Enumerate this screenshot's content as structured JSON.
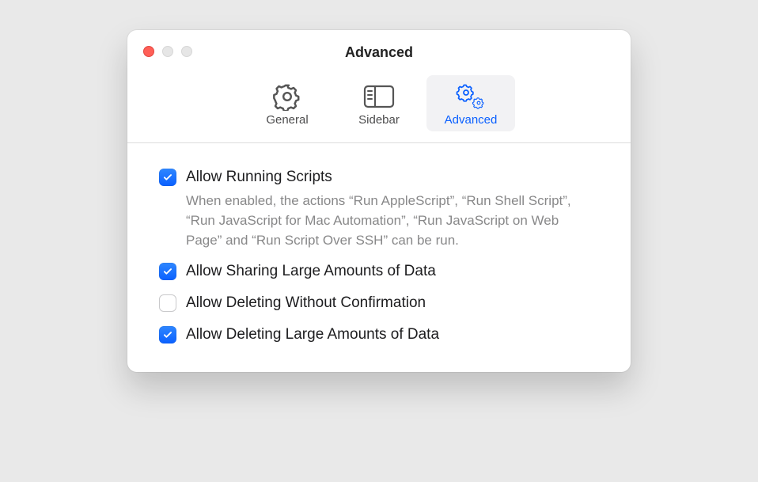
{
  "window": {
    "title": "Advanced"
  },
  "toolbar": {
    "tabs": [
      {
        "label": "General"
      },
      {
        "label": "Sidebar"
      },
      {
        "label": "Advanced"
      }
    ]
  },
  "settings": [
    {
      "label": "Allow Running Scripts",
      "description": "When enabled, the actions “Run AppleScript”, “Run Shell Script”, “Run JavaScript for Mac Automation”, “Run JavaScript on Web Page” and “Run Script Over SSH” can be run.",
      "checked": true
    },
    {
      "label": "Allow Sharing Large Amounts of Data",
      "description": "",
      "checked": true
    },
    {
      "label": "Allow Deleting Without Confirmation",
      "description": "",
      "checked": false
    },
    {
      "label": "Allow Deleting Large Amounts of Data",
      "description": "",
      "checked": true
    }
  ],
  "colors": {
    "accent": "#0a60ff"
  }
}
